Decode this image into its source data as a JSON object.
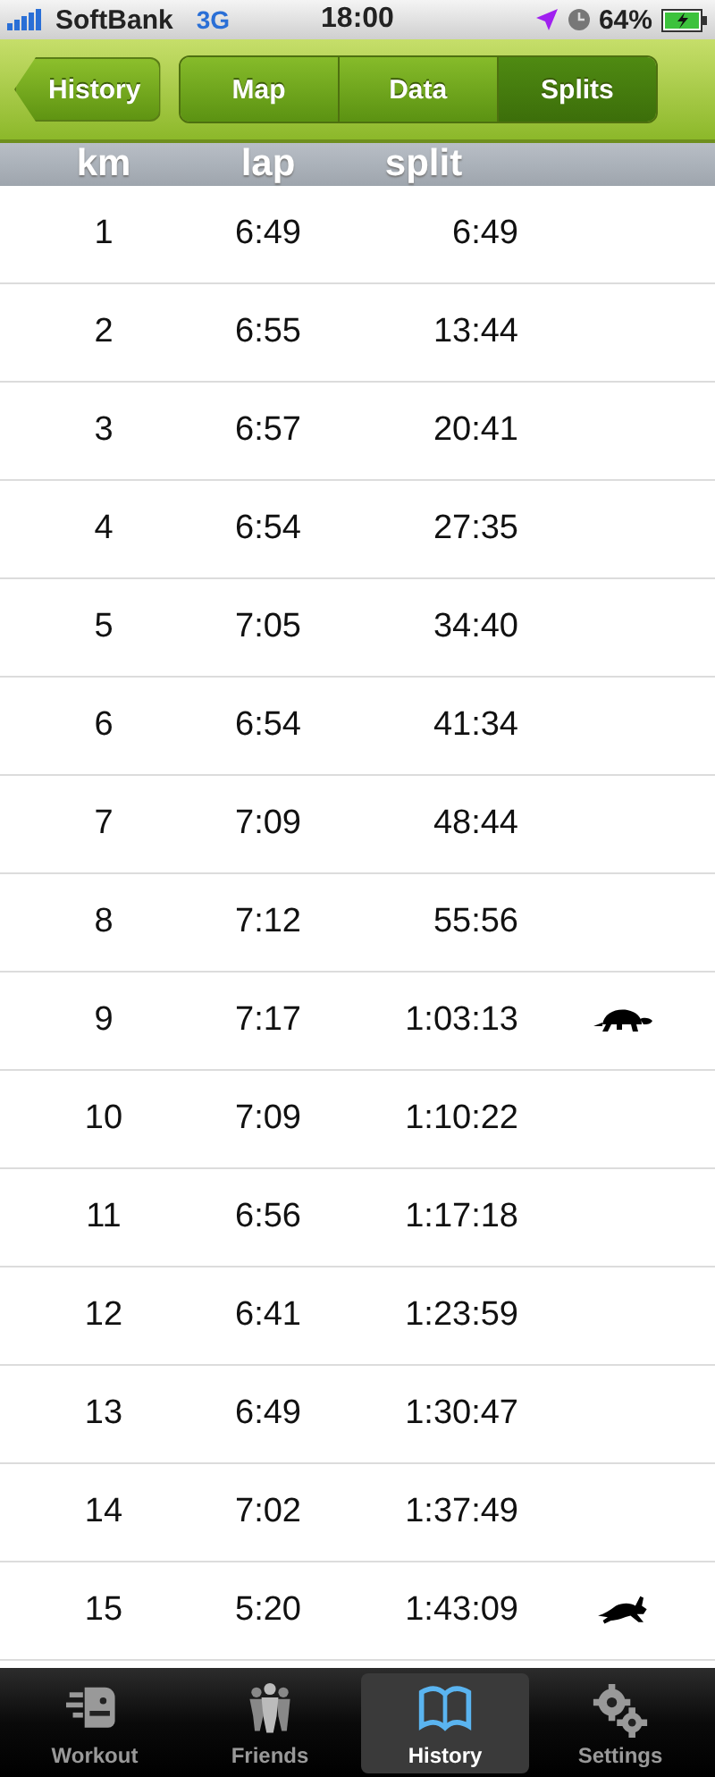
{
  "status_bar": {
    "carrier": "SoftBank",
    "network": "3G",
    "time": "18:00",
    "battery": "64%"
  },
  "nav_bar": {
    "back": "History",
    "segments": [
      {
        "label": "Map",
        "selected": false
      },
      {
        "label": "Data",
        "selected": false
      },
      {
        "label": "Splits",
        "selected": true
      }
    ]
  },
  "table": {
    "columns": [
      "km",
      "lap",
      "split"
    ],
    "rows": [
      {
        "km": "1",
        "lap": "6:49",
        "split": "6:49",
        "slowest": false,
        "fastest": false
      },
      {
        "km": "2",
        "lap": "6:55",
        "split": "13:44",
        "slowest": false,
        "fastest": false
      },
      {
        "km": "3",
        "lap": "6:57",
        "split": "20:41",
        "slowest": false,
        "fastest": false
      },
      {
        "km": "4",
        "lap": "6:54",
        "split": "27:35",
        "slowest": false,
        "fastest": false
      },
      {
        "km": "5",
        "lap": "7:05",
        "split": "34:40",
        "slowest": false,
        "fastest": false
      },
      {
        "km": "6",
        "lap": "6:54",
        "split": "41:34",
        "slowest": false,
        "fastest": false
      },
      {
        "km": "7",
        "lap": "7:09",
        "split": "48:44",
        "slowest": false,
        "fastest": false
      },
      {
        "km": "8",
        "lap": "7:12",
        "split": "55:56",
        "slowest": false,
        "fastest": false
      },
      {
        "km": "9",
        "lap": "7:17",
        "split": "1:03:13",
        "slowest": true,
        "fastest": false
      },
      {
        "km": "10",
        "lap": "7:09",
        "split": "1:10:22",
        "slowest": false,
        "fastest": false
      },
      {
        "km": "11",
        "lap": "6:56",
        "split": "1:17:18",
        "slowest": false,
        "fastest": false
      },
      {
        "km": "12",
        "lap": "6:41",
        "split": "1:23:59",
        "slowest": false,
        "fastest": false
      },
      {
        "km": "13",
        "lap": "6:49",
        "split": "1:30:47",
        "slowest": false,
        "fastest": false
      },
      {
        "km": "14",
        "lap": "7:02",
        "split": "1:37:49",
        "slowest": false,
        "fastest": false
      },
      {
        "km": "15",
        "lap": "5:20",
        "split": "1:43:09",
        "slowest": false,
        "fastest": true
      }
    ]
  },
  "tab_bar": [
    {
      "label": "Workout",
      "kind": "workout",
      "selected": false
    },
    {
      "label": "Friends",
      "kind": "friends",
      "selected": false
    },
    {
      "label": "History",
      "kind": "history",
      "selected": true
    },
    {
      "label": "Settings",
      "kind": "settings",
      "selected": false
    }
  ]
}
